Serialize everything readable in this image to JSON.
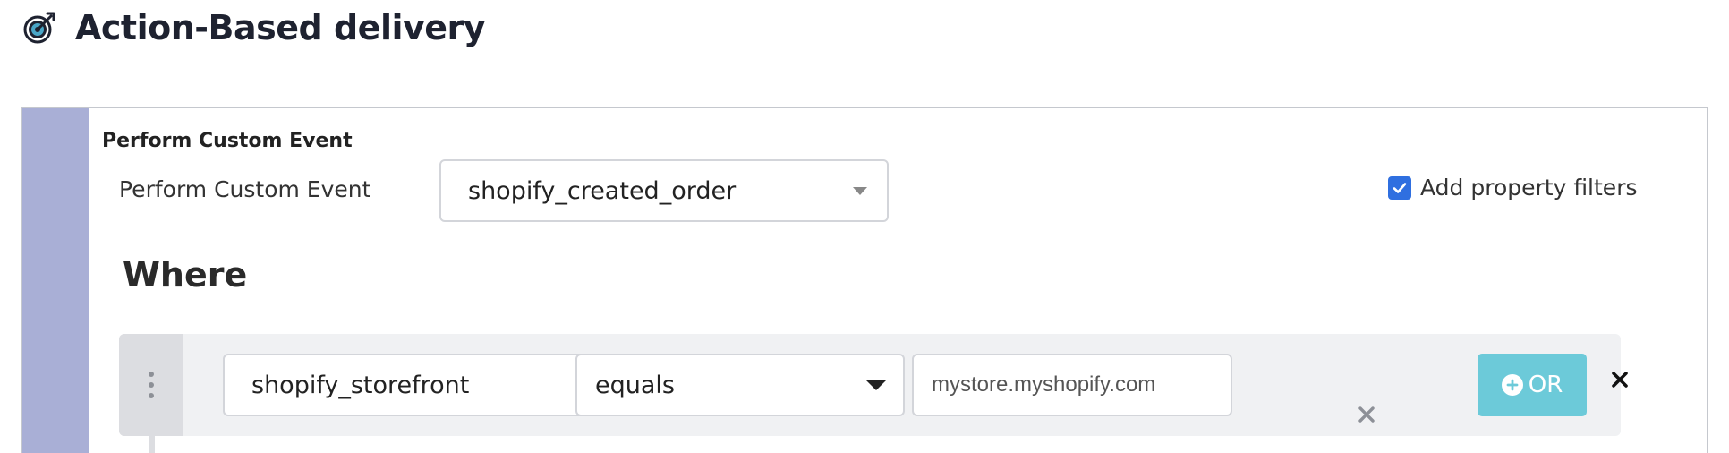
{
  "header": {
    "title": "Action-Based delivery",
    "icon": "target-icon"
  },
  "card": {
    "title": "Perform Custom Event",
    "event_label": "Perform Custom Event",
    "event_select_value": "shopify_created_order",
    "add_property_filters_label": "Add property filters",
    "add_property_filters_checked": true
  },
  "where": {
    "heading": "Where",
    "filter": {
      "property_value": "shopify_storefront",
      "operator_value": "equals",
      "value": "mystore.myshopify.com",
      "or_label": "OR"
    }
  },
  "colors": {
    "accent_bar": "#a9afd6",
    "or_button": "#6ccad9",
    "checkbox": "#2f6fe0"
  }
}
